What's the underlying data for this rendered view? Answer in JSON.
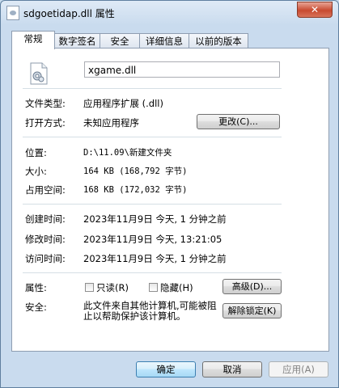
{
  "window": {
    "title": "sdgoetidap.dll 属性",
    "close_label": "✕"
  },
  "tabs": [
    "常规",
    "数字签名",
    "安全",
    "详细信息",
    "以前的版本"
  ],
  "file": {
    "name": "xgame.dll"
  },
  "props": {
    "type_label": "文件类型:",
    "type_value": "应用程序扩展 (.dll)",
    "open_label": "打开方式:",
    "open_value": "未知应用程序",
    "change_button": "更改(C)...",
    "location_label": "位置:",
    "location_value": "D:\\11.09\\新建文件夹",
    "size_label": "大小:",
    "size_value": "164 KB (168,792 字节)",
    "disk_label": "占用空间:",
    "disk_value": "168 KB (172,032 字节)",
    "created_label": "创建时间:",
    "created_value": "2023年11月9日 今天, 1 分钟之前",
    "modified_label": "修改时间:",
    "modified_value": "2023年11月9日 今天, 13:21:05",
    "accessed_label": "访问时间:",
    "accessed_value": "2023年11月9日 今天, 1 分钟之前",
    "attr_label": "属性:",
    "readonly_label": "只读(R)",
    "hidden_label": "隐藏(H)",
    "advanced_button": "高级(D)...",
    "security_label": "安全:",
    "security_text": "此文件来自其他计算机,可能被阻止以帮助保护该计算机。",
    "unblock_button": "解除锁定(K)"
  },
  "buttons": {
    "ok": "确定",
    "cancel": "取消",
    "apply": "应用(A)"
  }
}
